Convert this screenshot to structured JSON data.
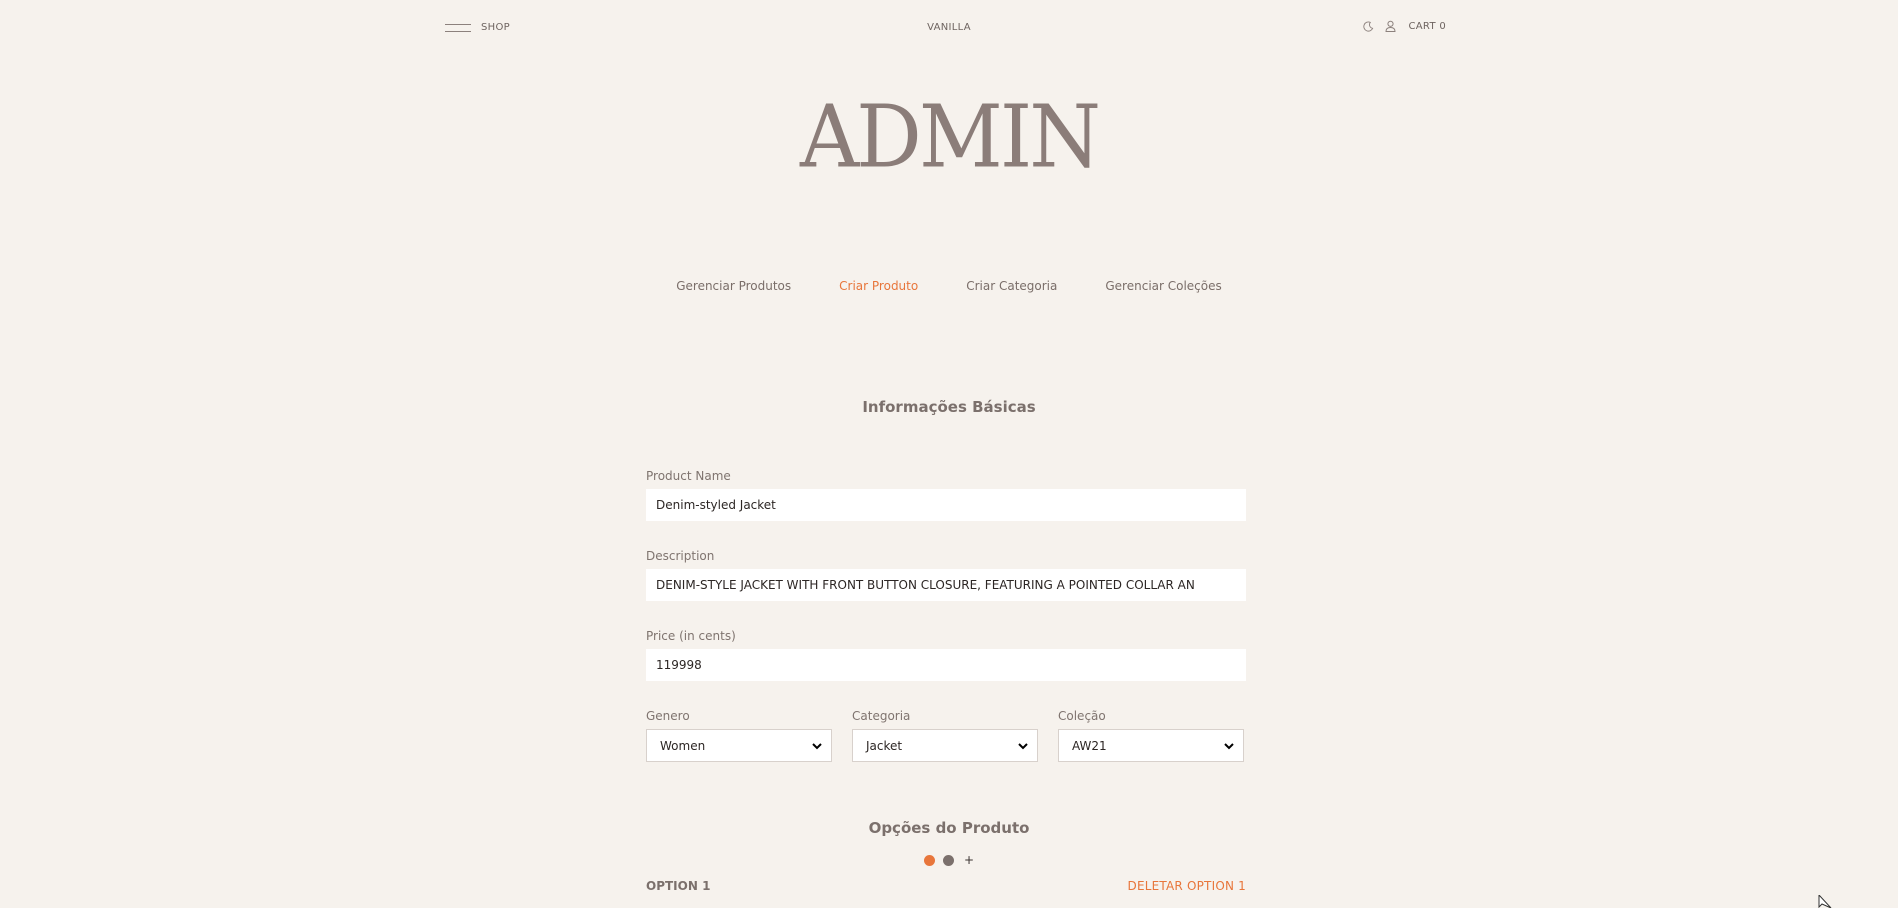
{
  "header": {
    "shop_label": "SHOP",
    "brand": "VANILLA",
    "cart_label": "CART 0",
    "icons": [
      "hamburger-icon",
      "moon-icon",
      "user-icon"
    ]
  },
  "page_title": "ADMIN",
  "tabs": [
    {
      "label": "Gerenciar Produtos",
      "active": false
    },
    {
      "label": "Criar Produto",
      "active": true
    },
    {
      "label": "Criar Categoria",
      "active": false
    },
    {
      "label": "Gerenciar Coleções",
      "active": false
    }
  ],
  "basic_info": {
    "title": "Informações Básicas",
    "product_name": {
      "label": "Product Name",
      "value": "Denim-styled Jacket"
    },
    "description": {
      "label": "Description",
      "value": "DENIM-STYLE JACKET WITH FRONT BUTTON CLOSURE, FEATURING A POINTED COLLAR AN"
    },
    "price": {
      "label": "Price (in cents)",
      "value": "119998"
    },
    "genero": {
      "label": "Genero",
      "value": "Women"
    },
    "categoria": {
      "label": "Categoria",
      "value": "Jacket"
    },
    "colecao": {
      "label": "Coleção",
      "value": "AW21"
    }
  },
  "options": {
    "title": "Opções do Produto",
    "add_symbol": "+",
    "current_label": "OPTION 1",
    "delete_label": "DELETAR OPTION 1"
  },
  "colors": {
    "background": "#f6f2ed",
    "accent": "#e8763b",
    "text": "#7a6e69",
    "input_bg": "#ffffff"
  }
}
